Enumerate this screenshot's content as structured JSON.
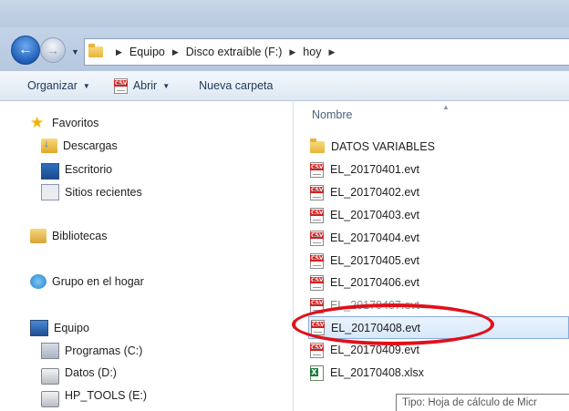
{
  "address": {
    "crumbs": [
      "Equipo",
      "Disco extraíble (F:)",
      "hoy"
    ]
  },
  "toolbar": {
    "organize_label": "Organizar",
    "open_label": "Abrir",
    "new_folder_label": "Nueva carpeta"
  },
  "nav": {
    "favorites": "Favoritos",
    "downloads": "Descargas",
    "desktop": "Escritorio",
    "recent": "Sitios recientes",
    "libraries": "Bibliotecas",
    "homegroup": "Grupo en el hogar",
    "computer": "Equipo",
    "drive_c": "Programas (C:)",
    "drive_d": "Datos (D:)",
    "drive_e": "HP_TOOLS (E:)"
  },
  "files": {
    "column_name": "Nombre",
    "items": [
      {
        "name": "DATOS VARIABLES",
        "type": "folder"
      },
      {
        "name": "EL_20170401.evt",
        "type": "csv"
      },
      {
        "name": "EL_20170402.evt",
        "type": "csv"
      },
      {
        "name": "EL_20170403.evt",
        "type": "csv"
      },
      {
        "name": "EL_20170404.evt",
        "type": "csv"
      },
      {
        "name": "EL_20170405.evt",
        "type": "csv"
      },
      {
        "name": "EL_20170406.evt",
        "type": "csv"
      },
      {
        "name": "EL_20170407.evt",
        "type": "csv"
      },
      {
        "name": "EL_20170408.evt",
        "type": "csv",
        "selected": true
      },
      {
        "name": "EL_20170409.evt",
        "type": "csv"
      },
      {
        "name": "EL_20170408.xlsx",
        "type": "xlsx"
      }
    ]
  },
  "tooltip": "Tipo: Hoja de cálculo de Micr",
  "colors": {
    "highlight_ellipse": "#e0101a",
    "selection_border": "#84acdd"
  }
}
